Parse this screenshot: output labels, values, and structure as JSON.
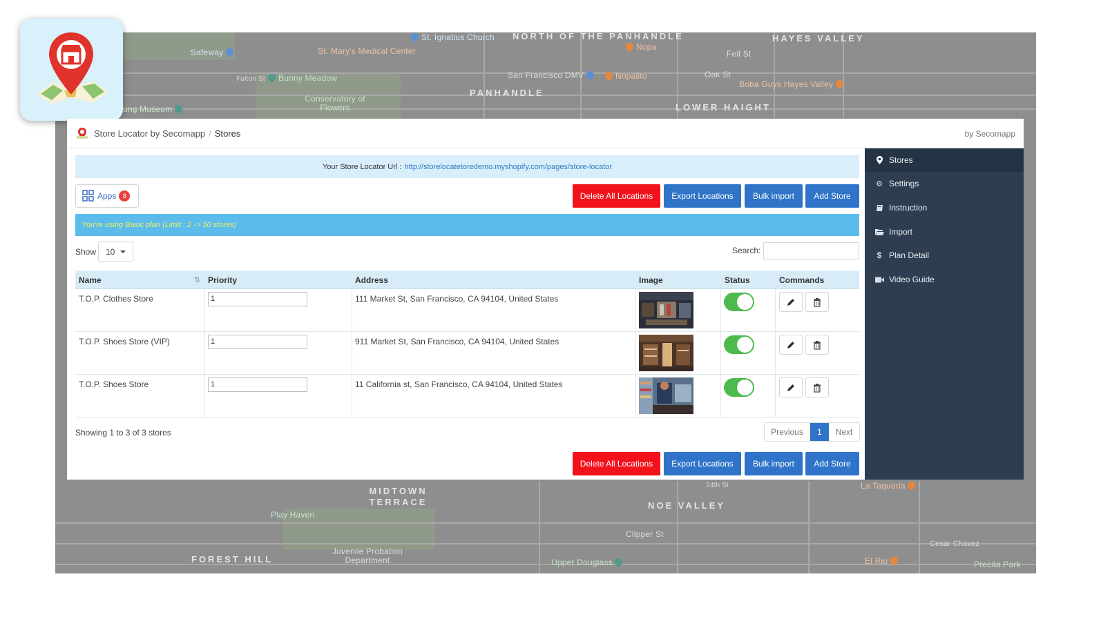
{
  "map": {
    "labels": {
      "st_ignatius": "St. Ignatius Church",
      "north_panhandle": "NORTH OF THE PANHANDLE",
      "hayes_valley": "HAYES VALLEY",
      "safeway": "Safeway",
      "st_marys": "St. Mary's Medical Center",
      "nopa": "Nopa",
      "fell_st": "Fell St",
      "bunny_meadow": "Bunny Meadow",
      "fulton_st": "Fulton St",
      "sf_dmv": "San Francisco DMV",
      "nopalito": "Nopalito",
      "oak_st": "Oak St",
      "boba_guys": "Boba Guys Hayes Valley",
      "panhandle": "PANHANDLE",
      "conservatory": "Conservatory of Flowers",
      "lower_haight": "LOWER HAIGHT",
      "museum": "ung Museum",
      "midtown_terrace": "MIDTOWN TERRACE",
      "noe_valley": "NOE VALLEY",
      "la_taqueria": "La Taqueria",
      "play_haven": "Play Haven",
      "forest_hill": "FOREST HILL",
      "juvenile": "Juvenile Probation Department",
      "clipper_st": "Clipper St",
      "cesar_chavez": "Cesar Chavez",
      "el_rio": "El Rio",
      "upper_douglass": "Upper Douglass",
      "precita_park": "Precita Park",
      "24th_st": "24th St"
    }
  },
  "header": {
    "app_name": "Store Locator by Secomapp",
    "separator": "/",
    "current": "Stores",
    "by": "by Secomapp"
  },
  "url_bar": {
    "label": "Your Store Locator Url :",
    "url": "http://storelocatetoredemo.myshopify.com/pages/store-locator"
  },
  "apps": {
    "label": "Apps",
    "count": "8"
  },
  "actions": {
    "delete_all": "Delete All Locations",
    "export": "Export Locations",
    "bulk_import": "Bulk import",
    "add_store": "Add Store"
  },
  "plan_notice": "You're using Basic plan (Limit : 2 -> 50 stores)",
  "table_controls": {
    "show_label": "Show",
    "show_value": "10",
    "search_label": "Search:"
  },
  "table": {
    "headers": [
      "Name",
      "Priority",
      "Address",
      "Image",
      "Status",
      "Commands"
    ],
    "rows": [
      {
        "name": "T.O.P. Clothes Store",
        "priority": "1",
        "address": "111 Market St, San Francisco, CA 94104, United States",
        "status": true
      },
      {
        "name": "T.O.P. Shoes Store (VIP)",
        "priority": "1",
        "address": "911 Market St, San Francisco, CA 94104, United States",
        "status": true
      },
      {
        "name": "T.O.P. Shoes Store",
        "priority": "1",
        "address": "11 California st, San Francisco, CA 94104, United States",
        "status": true
      }
    ]
  },
  "footer": {
    "showing": "Showing 1 to 3 of 3 stores",
    "prev": "Previous",
    "page": "1",
    "next": "Next"
  },
  "sidebar": {
    "items": [
      {
        "label": "Stores",
        "icon": "map-marker-icon"
      },
      {
        "label": "Settings",
        "icon": "gear-icon"
      },
      {
        "label": "Instruction",
        "icon": "book-icon"
      },
      {
        "label": "Import",
        "icon": "folder-open-icon"
      },
      {
        "label": "Plan Detail",
        "icon": "dollar-icon"
      },
      {
        "label": "Video Guide",
        "icon": "video-camera-icon"
      }
    ]
  },
  "colors": {
    "sidebar_bg": "#2e3e50",
    "danger": "#f2121c",
    "primary": "#2f74c8",
    "plan_bar": "#5bbcec",
    "url_bar": "#d9eefb",
    "toggle_on": "#4cba4c"
  }
}
